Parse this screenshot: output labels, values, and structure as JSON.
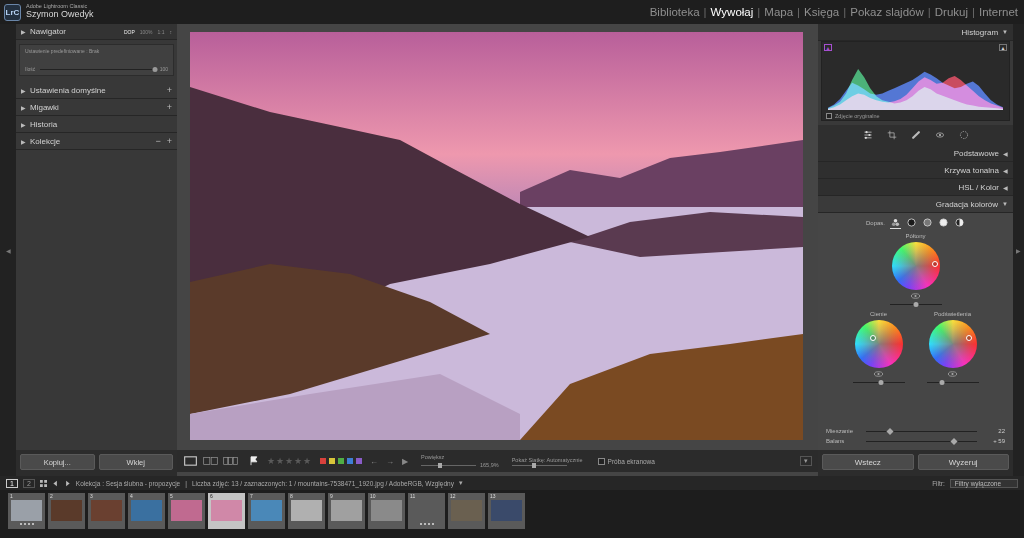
{
  "app": {
    "logo": "LrC",
    "product": "Adobe Lightroom Classic",
    "user": "Szymon Owedyk"
  },
  "modules": {
    "separator": "|",
    "items": [
      {
        "label": "Biblioteka",
        "selected": false
      },
      {
        "label": "Wywołaj",
        "selected": true
      },
      {
        "label": "Mapa",
        "selected": false
      },
      {
        "label": "Księga",
        "selected": false
      },
      {
        "label": "Pokaz slajdów",
        "selected": false
      },
      {
        "label": "Drukuj",
        "selected": false
      },
      {
        "label": "Internet",
        "selected": false
      }
    ]
  },
  "edges": {
    "left": "◀",
    "right": "▶"
  },
  "left_panel": {
    "navigator": {
      "arrow": "▶",
      "title": "Nawigator",
      "zoom_options": [
        {
          "label": "DOP",
          "selected": true
        },
        {
          "label": "100%",
          "selected": false
        },
        {
          "label": "1:1",
          "selected": false
        },
        {
          "label": "↕",
          "selected": false
        }
      ],
      "preset": "Ustawienie predefiniowane : Brak",
      "amount_label": "Ilość",
      "amount_value": "100",
      "amount_level": 1
    },
    "sections": [
      {
        "arrow": "▶",
        "title": "Ustawienia domyślne",
        "actions": [
          "+"
        ]
      },
      {
        "arrow": "▶",
        "title": "Migawki",
        "actions": [
          "+"
        ]
      },
      {
        "arrow": "▶",
        "title": "Historia",
        "actions": []
      },
      {
        "arrow": "▶",
        "title": "Kolekcje",
        "actions": [
          "−",
          "+"
        ]
      }
    ],
    "buttons": [
      "Kopiuj...",
      "Wklej"
    ]
  },
  "toolbar": {
    "stars": {
      "glyph": "★",
      "count": 5,
      "filled": 0
    },
    "color_labels": [
      {
        "color": "#d9413c",
        "selected": false
      },
      {
        "color": "#d8c53a",
        "selected": false
      },
      {
        "color": "#4fae45",
        "selected": false
      },
      {
        "color": "#3e7fd6",
        "selected": false
      },
      {
        "color": "#8a5cc8",
        "selected": false
      }
    ],
    "prev": "←",
    "next": "→",
    "play": "▶",
    "zoom": {
      "label": "Powiększ",
      "reading": "165,9%",
      "level": 0.35
    },
    "grid": {
      "label": "Pokaż Siatkę: Automatycznie",
      "level": 0.4
    },
    "proof": {
      "label": "Próba ekranowa",
      "checked": false
    },
    "menu": "▾"
  },
  "right_panel": {
    "histogram": {
      "title": "Histogram",
      "arrow": "▼",
      "clip": [
        {
          "glyph": "▲",
          "on": true,
          "color": "#a64fd0"
        },
        {
          "glyph": "▲",
          "on": false,
          "color": "#d8d8d8"
        }
      ],
      "series": [
        {
          "name": "red",
          "color": "#e0304a",
          "values": [
            2,
            5,
            10,
            18,
            25,
            30,
            28,
            22,
            18,
            15,
            14,
            16,
            20,
            28,
            40,
            52,
            60,
            55,
            48,
            50,
            58,
            62,
            55,
            45,
            35,
            25,
            18,
            12,
            8,
            4
          ]
        },
        {
          "name": "green",
          "color": "#30c070",
          "values": [
            3,
            8,
            15,
            30,
            55,
            75,
            60,
            40,
            25,
            18,
            15,
            12,
            14,
            18,
            25,
            35,
            42,
            38,
            30,
            26,
            22,
            18,
            14,
            10,
            8,
            6,
            5,
            4,
            3,
            2
          ]
        },
        {
          "name": "blue",
          "color": "#3a6cf0",
          "values": [
            4,
            10,
            20,
            35,
            50,
            45,
            38,
            30,
            28,
            30,
            35,
            40,
            45,
            50,
            55,
            62,
            70,
            65,
            58,
            50,
            45,
            40,
            42,
            48,
            52,
            44,
            30,
            18,
            10,
            5
          ]
        }
      ],
      "original": {
        "label": "Zdjęcie oryginalne",
        "checked": false
      }
    },
    "sections": [
      {
        "title": "Podstawowe",
        "arrow": "◀",
        "expanded": false
      },
      {
        "title": "Krzywa tonalna",
        "arrow": "◀",
        "expanded": false
      },
      {
        "title": "HSL / Kolor",
        "arrow": "◀",
        "expanded": false
      },
      {
        "title": "Gradacja kolorów",
        "arrow": "▼",
        "expanded": true
      }
    ],
    "grading": {
      "adjust_label": "Dopas.",
      "modes": [
        {
          "kind": "three",
          "selected": true
        },
        {
          "kind": "shadows",
          "selected": false
        },
        {
          "kind": "midtones",
          "selected": false
        },
        {
          "kind": "highlights",
          "selected": false
        },
        {
          "kind": "global",
          "selected": false
        }
      ],
      "midtones": {
        "label": "Półtony",
        "hue": 5,
        "sat": 0.8,
        "level": 0.5
      },
      "shadows": {
        "label": "Cienie",
        "hue": 135,
        "sat": 0.35,
        "level": 0.55
      },
      "highlights": {
        "label": "Podświetlenia",
        "hue": 20,
        "sat": 0.75,
        "level": 0.3
      },
      "blending": {
        "label": "Mieszanie",
        "value": "22",
        "level": 0.22
      },
      "balance": {
        "label": "Balans",
        "value": "+ 59",
        "level": 0.795
      }
    },
    "buttons": [
      "Wstecz",
      "Wyzeruj"
    ]
  },
  "filmstrip": {
    "pages": [
      {
        "label": "1",
        "selected": true
      },
      {
        "label": "2",
        "selected": false
      }
    ],
    "source": "Kolekcja : Sesja ślubna - propozycje",
    "separator": "|",
    "info": "Liczba zdjęć: 13 / zaznaczonych: 1 / mountains-7538471_1920.jpg / AdobeRGB, Względny",
    "dropdown": "▾",
    "filter_label": "Filtr:",
    "filter_value": "Filtry wyłączone",
    "thumbnails": [
      {
        "number": "1",
        "color": "#9aa0a8",
        "selected": false,
        "stars": 4
      },
      {
        "number": "2",
        "color": "#5a3a2a",
        "selected": false,
        "stars": 0
      },
      {
        "number": "3",
        "color": "#6a4030",
        "selected": false,
        "stars": 0
      },
      {
        "number": "4",
        "color": "#3a70a0",
        "selected": false,
        "stars": 0
      },
      {
        "number": "5",
        "color": "#c06a90",
        "selected": false,
        "stars": 0
      },
      {
        "number": "6",
        "color": "#d088a8",
        "selected": true,
        "stars": 0
      },
      {
        "number": "7",
        "color": "#4a88b8",
        "selected": false,
        "stars": 0
      },
      {
        "number": "8",
        "color": "#b0b0b0",
        "selected": false,
        "stars": 0
      },
      {
        "number": "9",
        "color": "#a0a0a0",
        "selected": false,
        "stars": 0
      },
      {
        "number": "10",
        "color": "#8a8a8a",
        "selected": false,
        "stars": 0
      },
      {
        "number": "11",
        "color": "#5a5a5a",
        "selected": false,
        "stars": 4
      },
      {
        "number": "12",
        "color": "#6a6050",
        "selected": false,
        "stars": 0
      },
      {
        "number": "13",
        "color": "#3a4a6a",
        "selected": false,
        "stars": 0
      }
    ]
  }
}
